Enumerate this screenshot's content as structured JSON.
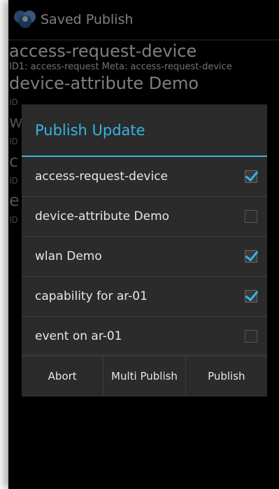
{
  "actionbar": {
    "title": "Saved Publish",
    "icon": "app-logo-icon"
  },
  "list": {
    "items": [
      {
        "title": "access-request-device",
        "subtitle": "ID1: access-request Meta: access-request-device"
      },
      {
        "title": "device-attribute Demo",
        "subtitle": "ID"
      },
      {
        "title": "w",
        "subtitle": "ID"
      },
      {
        "title": "c",
        "subtitle": "ID"
      },
      {
        "title": "e",
        "subtitle": "ID"
      }
    ]
  },
  "dialog": {
    "title": "Publish Update",
    "rows": [
      {
        "label": "access-request-device",
        "checked": true
      },
      {
        "label": "device-attribute Demo",
        "checked": false
      },
      {
        "label": "wlan Demo",
        "checked": true
      },
      {
        "label": "capability for ar-01",
        "checked": true
      },
      {
        "label": "event on ar-01",
        "checked": false
      }
    ],
    "buttons": {
      "abort": "Abort",
      "multi_publish": "Multi Publish",
      "publish": "Publish"
    }
  },
  "colors": {
    "accent": "#33b5e5",
    "dialog_bg": "#2b2b2b",
    "background": "#000000"
  }
}
